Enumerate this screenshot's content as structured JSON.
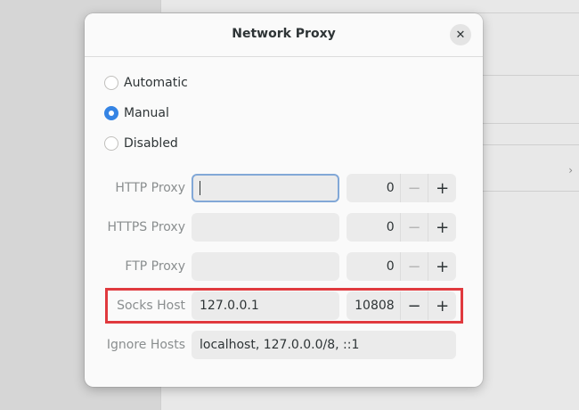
{
  "dialog": {
    "title": "Network Proxy",
    "close_icon": "close-icon"
  },
  "mode": {
    "options": [
      {
        "label": "Automatic",
        "selected": false
      },
      {
        "label": "Manual",
        "selected": true
      },
      {
        "label": "Disabled",
        "selected": false
      }
    ]
  },
  "proxies": [
    {
      "label": "HTTP Proxy",
      "host": "",
      "port": "0",
      "focused": true
    },
    {
      "label": "HTTPS Proxy",
      "host": "",
      "port": "0"
    },
    {
      "label": "FTP Proxy",
      "host": "",
      "port": "0"
    },
    {
      "label": "Socks Host",
      "host": "127.0.0.1",
      "port": "10808",
      "highlighted": true
    }
  ],
  "ignore_hosts": {
    "label": "Ignore Hosts",
    "value": "localhost, 127.0.0.0/8, ::1"
  },
  "spin": {
    "minus_symbol": "−",
    "plus_symbol": "+"
  },
  "colors": {
    "accent": "#3584e4",
    "highlight": "#e0393e"
  }
}
